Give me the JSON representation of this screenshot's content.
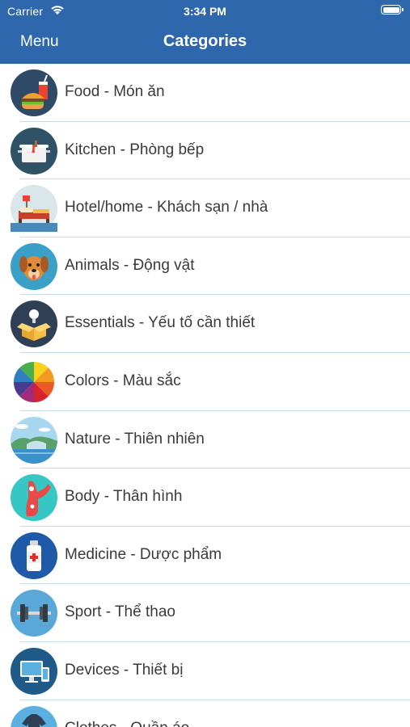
{
  "status_bar": {
    "carrier": "Carrier",
    "time": "3:34 PM"
  },
  "navbar": {
    "menu_label": "Menu",
    "title": "Categories"
  },
  "theme": {
    "nav_color": "#2f67ad",
    "separator_color": "#c9d9e6"
  },
  "categories": [
    {
      "label": "Food - Món ăn",
      "icon": "food-icon"
    },
    {
      "label": "Kitchen - Phòng bếp",
      "icon": "kitchen-icon"
    },
    {
      "label": "Hotel/home - Khách sạn / nhà",
      "icon": "hotel-icon"
    },
    {
      "label": "Animals - Động vật",
      "icon": "dog-icon"
    },
    {
      "label": "Essentials - Yếu tố cần thiết",
      "icon": "essentials-box-icon"
    },
    {
      "label": "Colors - Màu sắc",
      "icon": "color-wheel-icon"
    },
    {
      "label": "Nature - Thiên nhiên",
      "icon": "nature-icon"
    },
    {
      "label": "Body - Thân hình",
      "icon": "body-icon"
    },
    {
      "label": "Medicine - Dược phẩm",
      "icon": "medicine-icon"
    },
    {
      "label": "Sport - Thể thao",
      "icon": "dumbbell-icon"
    },
    {
      "label": "Devices - Thiết bị",
      "icon": "devices-icon"
    },
    {
      "label": "Clothes - Quần áo",
      "icon": "clothes-icon"
    }
  ]
}
